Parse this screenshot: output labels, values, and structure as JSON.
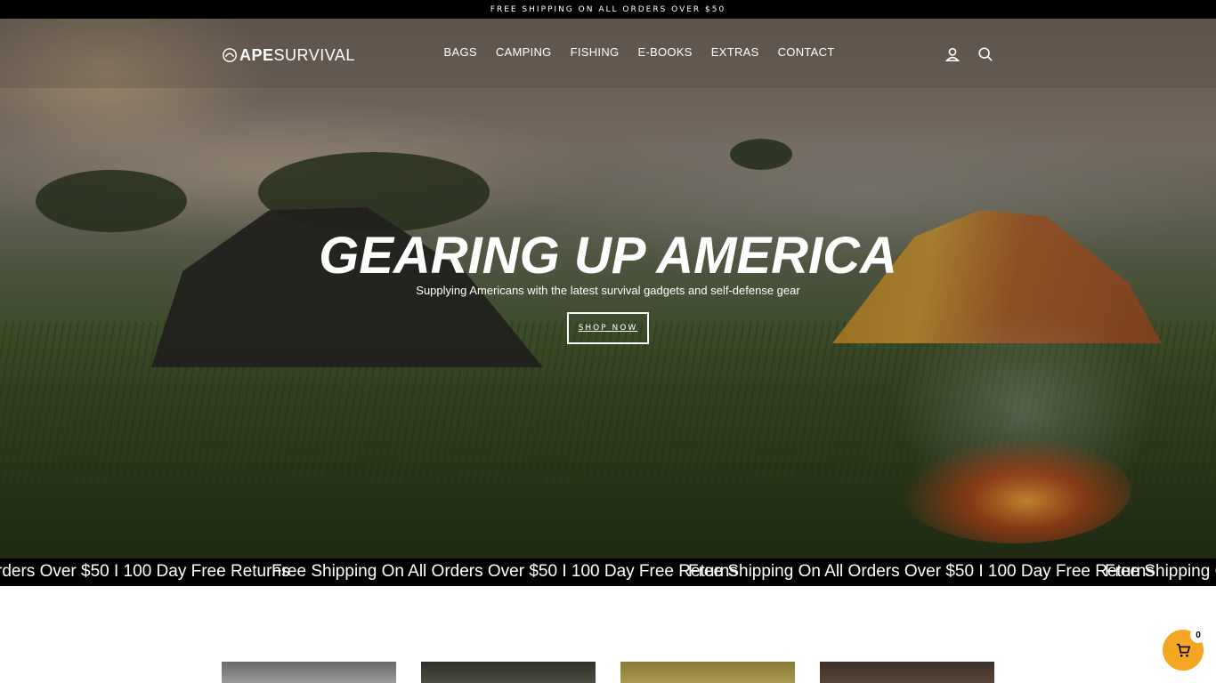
{
  "announcement": "FREE SHIPPING ON ALL ORDERS OVER $50",
  "logo": {
    "bold": "APE",
    "light": "SURVIVAL"
  },
  "nav": {
    "items": [
      "BAGS",
      "CAMPING",
      "FISHING",
      "E-BOOKS",
      "EXTRAS",
      "CONTACT"
    ],
    "account_icon": "account-icon",
    "search_icon": "search-icon"
  },
  "hero": {
    "title": "GEARING UP AMERICA",
    "subtitle": "Supplying Americans with the latest survival gadgets and self-defense gear",
    "cta": "SHOP NOW"
  },
  "ticker": {
    "items": [
      "rders Over $50 I 100 Day Free Returns",
      "Free Shipping On All Orders Over $50 I 100 Day Free Returns",
      "Free Shipping On All Orders Over $50 I 100 Day Free Returns",
      "Free Shipping On"
    ]
  },
  "cart": {
    "count": "0",
    "icon": "cart-icon",
    "color": "#f5a623"
  }
}
